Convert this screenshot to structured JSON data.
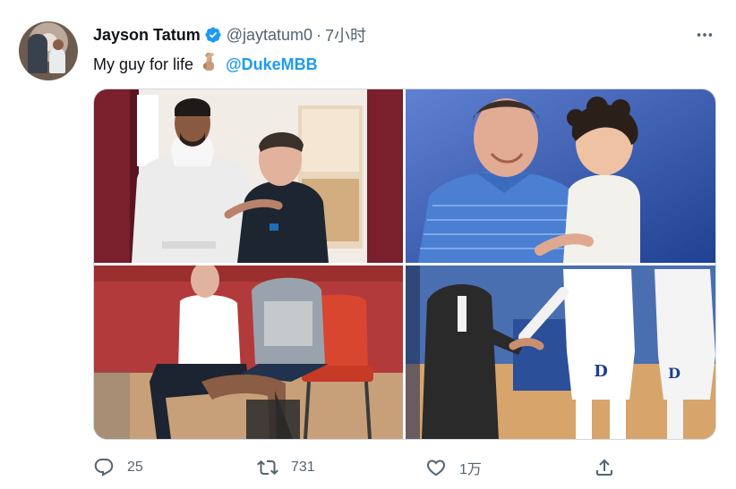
{
  "tweet": {
    "author": {
      "name": "Jayson Tatum",
      "handle": "@jaytatum0",
      "verified": true
    },
    "separator": "·",
    "time": "7小时",
    "text": {
      "body": "My guy for life",
      "emoji": "crossed-fingers-emoji",
      "mention": "@DukeMBB"
    },
    "media": {
      "photos": [
        "photo-1",
        "photo-2",
        "photo-3",
        "photo-4"
      ]
    },
    "actions": {
      "reply_count": "25",
      "retweet_count": "731",
      "like_count": "1万"
    }
  },
  "colors": {
    "text": "#0f1419",
    "secondary": "#536471",
    "accent": "#1d9bf0",
    "border": "#cfd9de"
  },
  "icons": [
    "verified-badge-icon",
    "more-icon",
    "reply-icon",
    "retweet-icon",
    "like-icon",
    "share-icon"
  ]
}
